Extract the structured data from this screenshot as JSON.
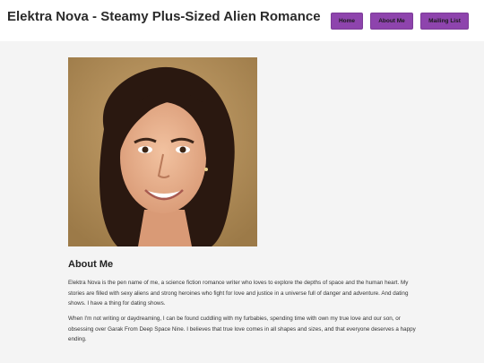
{
  "header": {
    "title": "Elektra Nova - Steamy Plus-Sized Alien Romance",
    "nav": [
      {
        "label": "Home"
      },
      {
        "label": "About Me"
      },
      {
        "label": "Mailing List"
      }
    ],
    "accent_color": "#8e44ad"
  },
  "main": {
    "photo_icon": "author-portrait",
    "about_heading": "About Me",
    "paragraphs": [
      "Elektra Nova is the pen name of me, a science fiction romance writer who loves to explore the depths of space and the human heart. My stories are filled with sexy aliens and strong heroines who fight for love and justice in a universe full of danger and adventure. And dating shows. I have a thing for dating shows.",
      "When I'm not writing or daydreaming, I can be found cuddling with my furbabies, spending time with own my true love and our son, or obsessing over Garak From Deep Space Nine. I believes that true love comes in all shapes and sizes, and that everyone deserves a happy ending."
    ]
  }
}
